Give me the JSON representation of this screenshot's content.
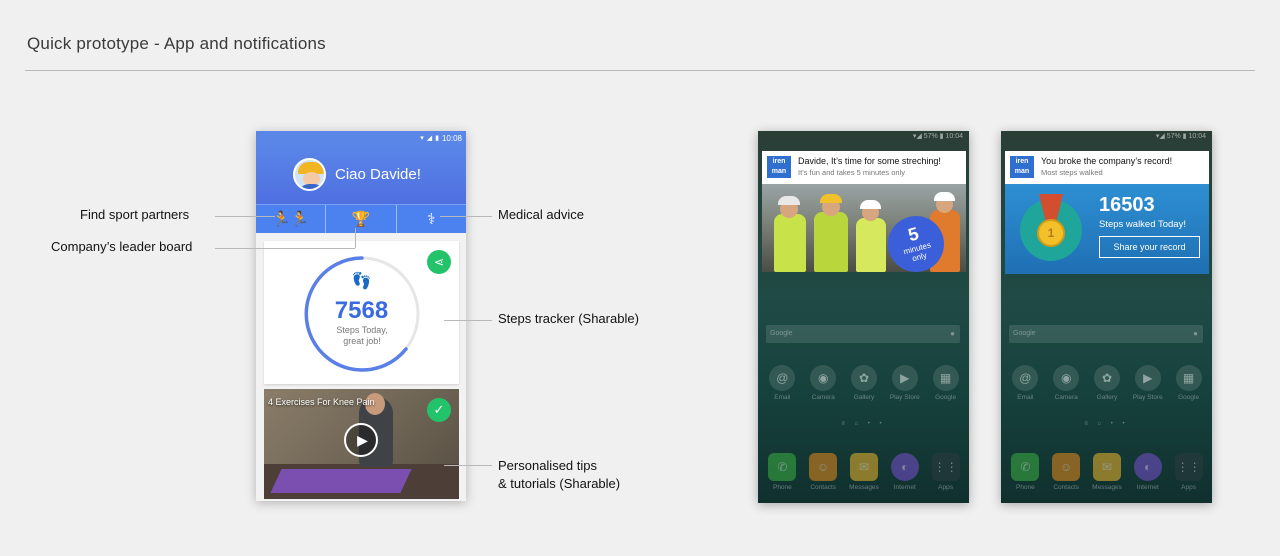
{
  "page": {
    "title": "Quick prototype - App and notifications"
  },
  "app": {
    "status_time": "10:08",
    "greeting": "Ciao Davide!",
    "tabs": [
      {
        "label": "🏃🏃",
        "icon": "running-people-icon"
      },
      {
        "label": "🏆",
        "icon": "trophy-icon"
      },
      {
        "label": "⚕",
        "icon": "stethoscope-icon"
      }
    ],
    "steps": {
      "value": "7568",
      "caption": "Steps Today, great job!"
    },
    "video": {
      "title": "4 Exercises For Knee Pain"
    }
  },
  "callouts": {
    "find_partners": "Find sport partners",
    "leader_board": "Company’s leader board",
    "medical": "Medical advice",
    "steps_tracker": "Steps tracker (Sharable)",
    "tips_line1": "Personalised tips",
    "tips_line2": "& tutorials (Sharable)"
  },
  "notification_1": {
    "logo": "iren man",
    "title": "Davide, It’s time for some streching!",
    "subtitle": "It’s fun and takes 5 minutes only",
    "badge_number": "5",
    "badge_word1": "minutes",
    "badge_word2": "only"
  },
  "notification_2": {
    "logo": "iren man",
    "title": "You broke the company’s record!",
    "subtitle": "Most steps walked",
    "medal_number": "1",
    "record_value": "16503",
    "record_caption": "Steps walked Today!",
    "button": "Share your record"
  },
  "home": {
    "search_placeholder": "Google",
    "apps": [
      "Email",
      "Camera",
      "Gallery",
      "Play Store",
      "Google"
    ],
    "dock": [
      "Phone",
      "Contacts",
      "Messages",
      "Internet",
      "Apps"
    ]
  },
  "colors": {
    "app_blue": "#4c82f0",
    "accent_green": "#22c36a",
    "steps_blue": "#3a6ae0"
  }
}
